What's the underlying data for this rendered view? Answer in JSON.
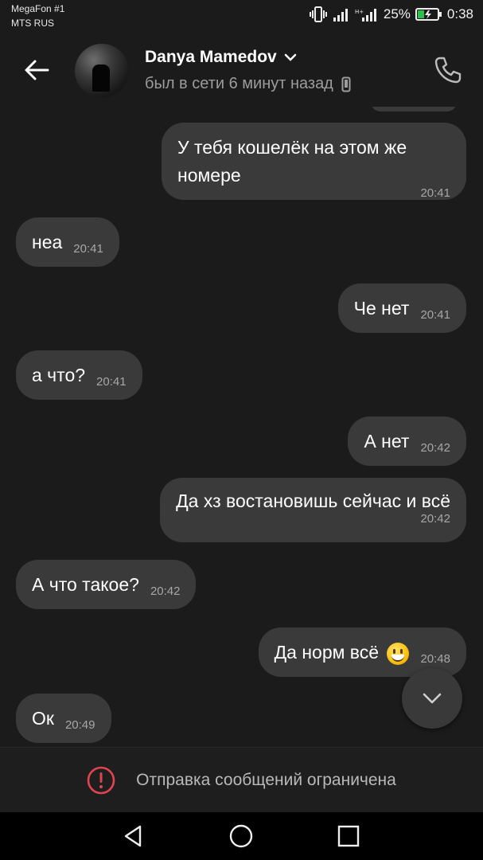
{
  "status_bar": {
    "carrier_1": "MegaFon #1",
    "carrier_2": "MTS RUS",
    "battery_percent": "25%",
    "time": "0:38"
  },
  "header": {
    "contact_name": "Danya Mamedov",
    "status": "был в сети 6 минут назад",
    "icons": [
      "back-arrow-icon",
      "chevron-down-icon",
      "phone-device-icon",
      "phone-call-icon"
    ]
  },
  "messages": [
    {
      "side": "out",
      "text": "У тебя кошелёк на этом же номере",
      "time": "20:41"
    },
    {
      "side": "in",
      "text": "неа",
      "time": "20:41"
    },
    {
      "side": "out",
      "text": "Че нет",
      "time": "20:41"
    },
    {
      "side": "in",
      "text": "а что?",
      "time": "20:41"
    },
    {
      "side": "out",
      "text": "А нет",
      "time": "20:42"
    },
    {
      "side": "out",
      "text": "Да хз востановишь сейчас и всё",
      "time": "20:42"
    },
    {
      "side": "in",
      "text": "А что такое?",
      "time": "20:42"
    },
    {
      "side": "out",
      "text": "Да норм всё",
      "emoji": "grinning-face",
      "time": "20:48"
    },
    {
      "side": "in",
      "text": "Ок",
      "time": "20:49"
    }
  ],
  "restriction": {
    "text": "Отправка сообщений ограничена",
    "icon": "alert-circle-icon",
    "icon_color": "#e0454f"
  },
  "colors": {
    "background": "#1b1b1b",
    "bubble": "#3a3a3a",
    "battery_charge": "#27c24c"
  }
}
